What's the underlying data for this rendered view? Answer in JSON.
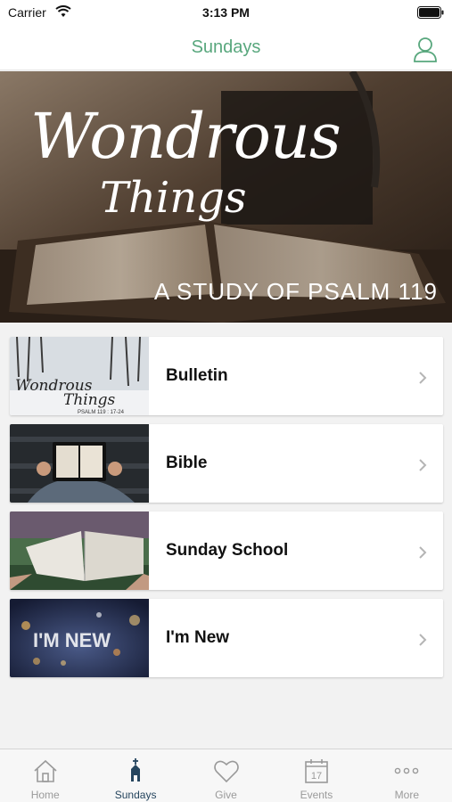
{
  "status_bar": {
    "carrier": "Carrier",
    "time": "3:13 PM"
  },
  "nav": {
    "title": "Sundays",
    "profile_icon": "person-outline-icon",
    "accent_color": "#58a77d"
  },
  "hero": {
    "title": "Wondrous",
    "subtitle": "Things",
    "caption": "A STUDY OF PSALM 119"
  },
  "menu": {
    "items": [
      {
        "label": "Bulletin",
        "thumb_text_1": "Wondrous",
        "thumb_text_2": "Things",
        "thumb_text_3": "PSALM 119 : 17-24"
      },
      {
        "label": "Bible"
      },
      {
        "label": "Sunday School"
      },
      {
        "label": "I'm New",
        "thumb_text_1": "I'M NEW"
      }
    ]
  },
  "tab_bar": {
    "active_color": "#25455e",
    "inactive_color": "#9a9a9a",
    "tabs": [
      {
        "label": "Home",
        "icon": "home-icon"
      },
      {
        "label": "Sundays",
        "icon": "church-icon"
      },
      {
        "label": "Give",
        "icon": "heart-icon"
      },
      {
        "label": "Events",
        "icon": "calendar-icon",
        "icon_text": "17"
      },
      {
        "label": "More",
        "icon": "more-dots-icon"
      }
    ]
  }
}
